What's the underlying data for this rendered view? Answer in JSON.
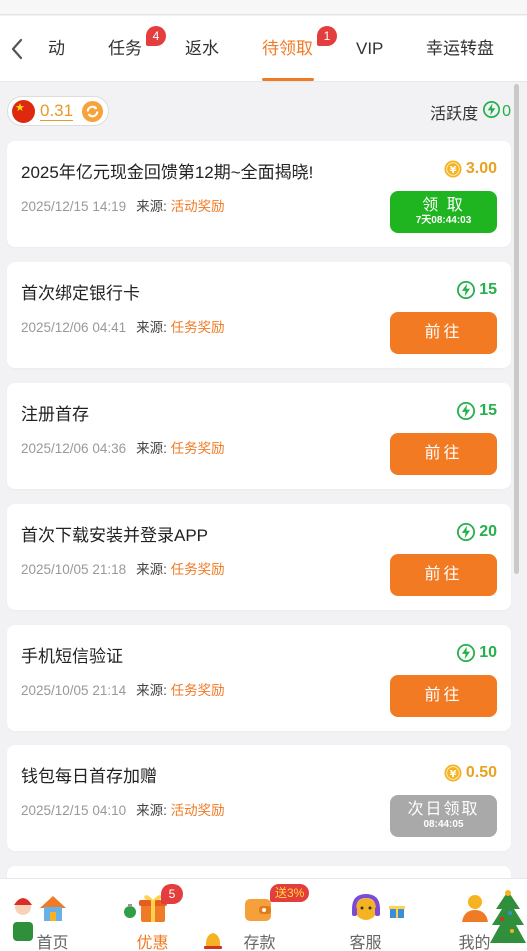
{
  "tabs": {
    "items": [
      {
        "label": "动",
        "badge": ""
      },
      {
        "label": "任务",
        "badge": "4"
      },
      {
        "label": "返水",
        "badge": ""
      },
      {
        "label": "待领取",
        "badge": "1"
      },
      {
        "label": "VIP",
        "badge": ""
      },
      {
        "label": "幸运转盘",
        "badge": ""
      }
    ],
    "active_index": 3
  },
  "balance": {
    "value": "0.31"
  },
  "activity": {
    "label": "活跃度",
    "value": "0"
  },
  "cards": [
    {
      "title": "2025年亿元现金回馈第12期~全面揭晓!",
      "time": "2025/12/15 14:19",
      "source_label": "来源:",
      "source": "活动奖励",
      "reward_type": "coin-icon",
      "reward": "3.00",
      "button": {
        "label": "领 取",
        "sub": "7天08:44:03",
        "style": "green"
      }
    },
    {
      "title": "首次绑定银行卡",
      "time": "2025/12/06 04:41",
      "source_label": "来源:",
      "source": "任务奖励",
      "reward_type": "bolt-icon",
      "reward": "15",
      "button": {
        "label": "前往",
        "sub": "",
        "style": "orange"
      }
    },
    {
      "title": "注册首存",
      "time": "2025/12/06 04:36",
      "source_label": "来源:",
      "source": "任务奖励",
      "reward_type": "bolt-icon",
      "reward": "15",
      "button": {
        "label": "前往",
        "sub": "",
        "style": "orange"
      }
    },
    {
      "title": "首次下载安装并登录APP",
      "time": "2025/10/05 21:18",
      "source_label": "来源:",
      "source": "任务奖励",
      "reward_type": "bolt-icon",
      "reward": "20",
      "button": {
        "label": "前往",
        "sub": "",
        "style": "orange"
      }
    },
    {
      "title": "手机短信验证",
      "time": "2025/10/05 21:14",
      "source_label": "来源:",
      "source": "任务奖励",
      "reward_type": "bolt-icon",
      "reward": "10",
      "button": {
        "label": "前往",
        "sub": "",
        "style": "orange"
      }
    },
    {
      "title": "钱包每日首存加赠",
      "time": "2025/12/15 04:10",
      "source_label": "来源:",
      "source": "活动奖励",
      "reward_type": "coin-icon",
      "reward": "0.50",
      "button": {
        "label": "次日领取",
        "sub": "08:44:05",
        "style": "gray"
      }
    }
  ],
  "bottom_nav": {
    "items": [
      {
        "label": "首页",
        "icon": "home-icon",
        "badge": ""
      },
      {
        "label": "优惠",
        "icon": "gift-icon",
        "badge": "5"
      },
      {
        "label": "存款",
        "icon": "wallet-icon",
        "badge": "送3%"
      },
      {
        "label": "客服",
        "icon": "support-icon",
        "badge": ""
      },
      {
        "label": "我的",
        "icon": "profile-icon",
        "badge": ""
      }
    ],
    "active_index": 1
  },
  "colors": {
    "accent": "#f07b26",
    "green": "#1fb520",
    "bolt_green": "#24b04a",
    "coin_gold": "#e9a21f",
    "badge_red": "#e33d3d",
    "disabled_gray": "#a9a9a9"
  }
}
